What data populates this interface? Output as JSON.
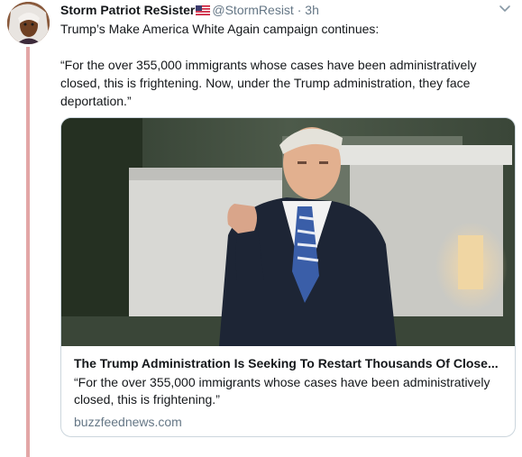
{
  "tweet": {
    "display_name": "Storm Patriot ReSister",
    "flag_icon": "us-flag-icon",
    "handle": "@StormResist",
    "separator": "·",
    "time": "3h",
    "text_line1": "Trump’s Make America White Again campaign continues:",
    "text_quote": "“For the over 355,000 immigrants whose cases have been administratively closed, this is frightening. Now, under the Trump administration, they face deportation.”"
  },
  "card": {
    "title": "The Trump Administration Is Seeking To Restart Thousands Of Close...",
    "description": "“For the over 355,000 immigrants whose cases have been administratively closed, this is frightening.”",
    "domain": "buzzfeednews.com"
  },
  "colors": {
    "thread_line": "#e3a6a6",
    "secondary_text": "#657786",
    "card_border": "#ccd6dd"
  },
  "icons": {
    "menu": "chevron-down-icon"
  }
}
